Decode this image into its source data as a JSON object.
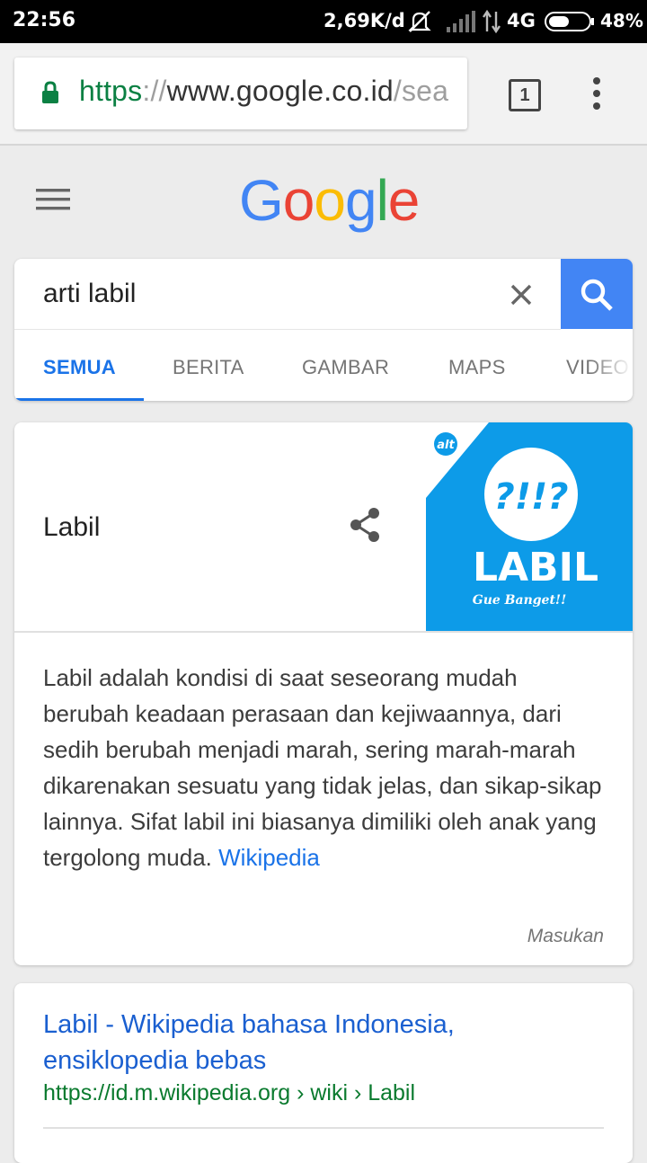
{
  "status_bar": {
    "time": "22:56",
    "speed": "2,69K/d",
    "network": "4G",
    "battery": "48%",
    "icons": [
      "mute-icon",
      "signal-icon",
      "data-arrows-icon",
      "battery-icon"
    ]
  },
  "browser": {
    "url_scheme": "https",
    "url_separator": "://",
    "url_host": "www.google.co.id",
    "url_path": "/sea",
    "tab_count": "1",
    "secure_color": "#0b8043"
  },
  "google": {
    "logo_letters": [
      "G",
      "o",
      "o",
      "g",
      "l",
      "e"
    ],
    "logo_colors": [
      "#4285f4",
      "#ea4335",
      "#fbbc05",
      "#4285f4",
      "#34a853",
      "#ea4335"
    ],
    "query": "arti labil",
    "tabs": [
      "SEMUA",
      "BERITA",
      "GAMBAR",
      "MAPS",
      "VIDEO"
    ],
    "active_tab": "SEMUA"
  },
  "knowledge_panel": {
    "title": "Labil",
    "description": "Labil adalah kondisi di saat seseorang mudah berubah keadaan perasaan dan kejiwaannya, dari sedih berubah menjadi marah, sering marah-marah dikarenakan sesuatu yang tidak jelas, dan sikap-sikap lainnya. Sifat labil ini biasanya dimiliki oleh anak yang tergolong muda.",
    "source": "Wikipedia",
    "feedback": "Masukan",
    "image": {
      "badge": "alt",
      "marks": "?!!?",
      "word": "LABIL",
      "tagline": "Gue Banget!!",
      "bg_color": "#0d9be8"
    }
  },
  "results": [
    {
      "title": "Labil - Wikipedia bahasa Indonesia, ensiklopedia bebas",
      "url": "https://id.m.wikipedia.org › wiki › Labil"
    }
  ]
}
